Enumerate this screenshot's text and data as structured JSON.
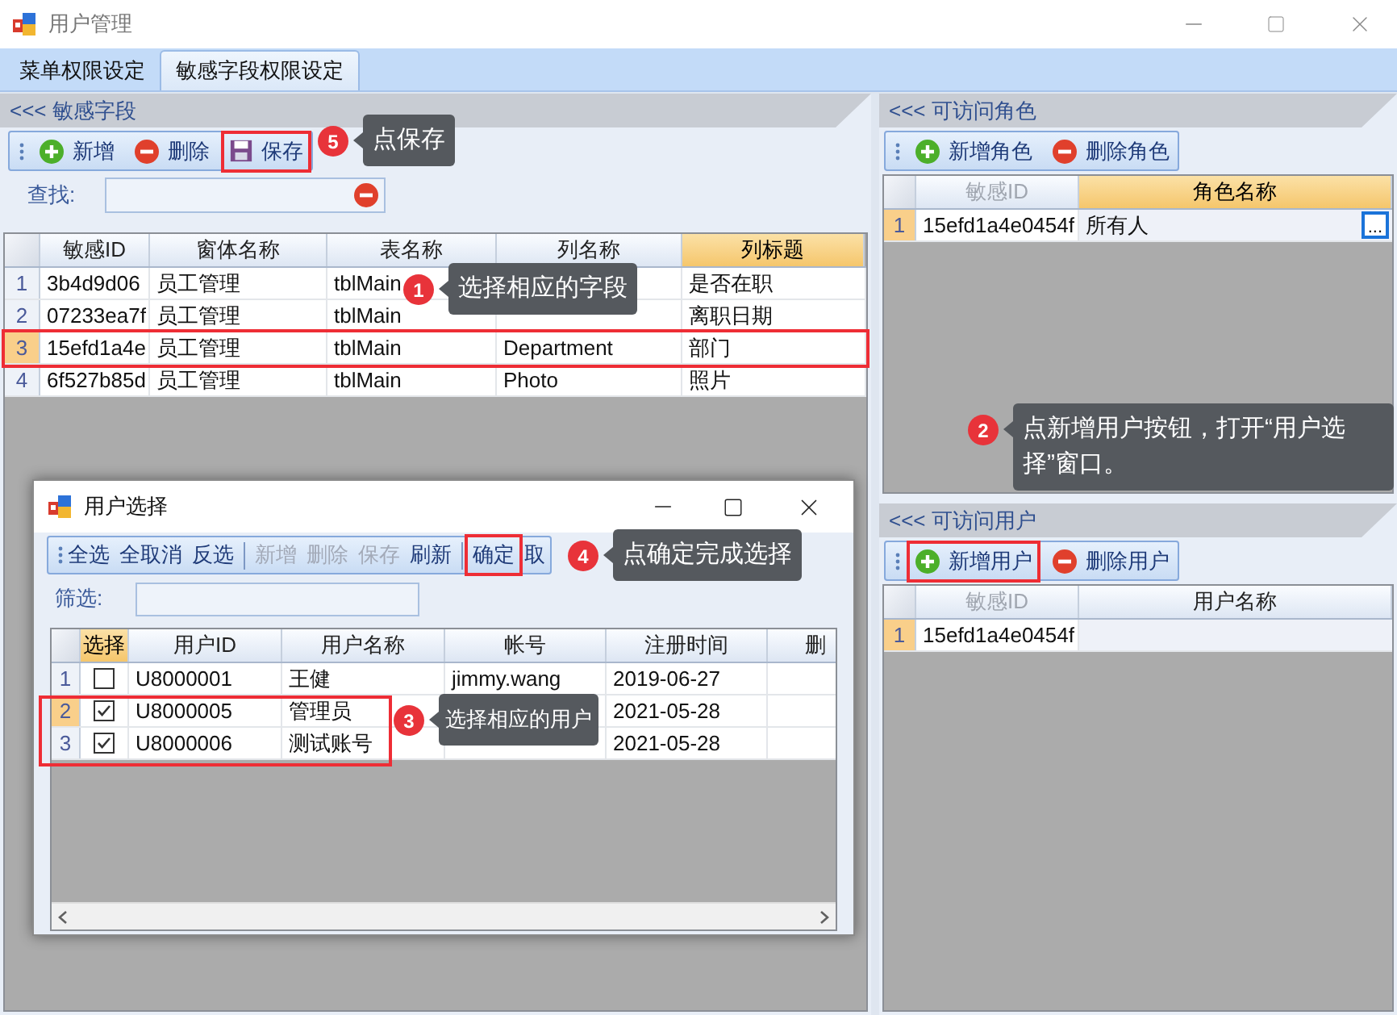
{
  "window": {
    "title": "用户管理"
  },
  "tabs": [
    {
      "label": "菜单权限设定",
      "selected": false
    },
    {
      "label": "敏感字段权限设定",
      "selected": true
    }
  ],
  "fields_panel": {
    "header": "<<< 敏感字段",
    "toolbar": [
      {
        "label": "新增",
        "kind": "add"
      },
      {
        "label": "删除",
        "kind": "remove"
      },
      {
        "label": "保存",
        "kind": "save",
        "highlighted": true
      }
    ],
    "search": {
      "label": "查找:"
    },
    "table": {
      "columns": [
        {
          "label": "敏感ID",
          "selected": false
        },
        {
          "label": "窗体名称",
          "selected": false
        },
        {
          "label": "表名称",
          "selected": false
        },
        {
          "label": "列名称",
          "selected": false
        },
        {
          "label": "列标题",
          "selected": true
        }
      ],
      "rows": [
        {
          "number": "1",
          "selected": false,
          "sensitive_id": "3b4d9d06",
          "form": "员工管理",
          "table": "tblMain",
          "caption": "是否在职"
        },
        {
          "number": "2",
          "selected": false,
          "sensitive_id": "07233ea7f",
          "form": "员工管理",
          "table": "tblMain",
          "caption": "离职日期"
        },
        {
          "number": "3",
          "selected": true,
          "highlighted": true,
          "sensitive_id": "15efd1a4e",
          "form": "员工管理",
          "table": "tblMain",
          "column": "Department",
          "caption": "部门"
        },
        {
          "number": "4",
          "selected": false,
          "sensitive_id": "6f527b85d",
          "form": "员工管理",
          "table": "tblMain",
          "column": "Photo",
          "caption": "照片"
        }
      ]
    }
  },
  "roles_panel": {
    "header": "<<< 可访问角色",
    "toolbar": [
      {
        "label": "新增角色",
        "kind": "add"
      },
      {
        "label": "删除角色",
        "kind": "remove"
      }
    ],
    "table": {
      "columns": [
        {
          "label": "敏感ID",
          "selected": false,
          "disabled": true
        },
        {
          "label": "角色名称",
          "selected": true,
          "disabled": false
        }
      ],
      "rows": [
        {
          "number": "1",
          "selected": true,
          "sensitive_id": "15efd1a4e0454f",
          "name": "所有人",
          "edit_button": "..."
        }
      ]
    }
  },
  "users_panel": {
    "header": "<<< 可访问用户",
    "toolbar": [
      {
        "label": "新增用户",
        "kind": "add",
        "highlighted": true
      },
      {
        "label": "删除用户",
        "kind": "remove"
      }
    ],
    "table": {
      "columns": [
        {
          "label": "敏感ID",
          "selected": false,
          "disabled": true
        },
        {
          "label": "用户名称",
          "selected": false,
          "disabled": false
        }
      ],
      "rows": [
        {
          "number": "1",
          "selected": true,
          "sensitive_id": "15efd1a4e0454f"
        }
      ]
    }
  },
  "dialog": {
    "title": "用户选择",
    "toolbar": [
      {
        "kind": "button",
        "label": "全选",
        "disabled": false
      },
      {
        "kind": "button",
        "label": "全取消",
        "disabled": false
      },
      {
        "kind": "button",
        "label": "反选",
        "disabled": false
      },
      {
        "kind": "separator"
      },
      {
        "kind": "button",
        "label": "新增",
        "disabled": true
      },
      {
        "kind": "button",
        "label": "删除",
        "disabled": true
      },
      {
        "kind": "button",
        "label": "保存",
        "disabled": true
      },
      {
        "kind": "button",
        "label": "刷新",
        "disabled": false
      },
      {
        "kind": "separator"
      },
      {
        "kind": "button",
        "label": "确定",
        "disabled": false,
        "highlighted": true
      },
      {
        "kind": "button",
        "label": "取",
        "disabled": false
      }
    ],
    "filter": {
      "label": "筛选:"
    },
    "table": {
      "columns": [
        {
          "label": "选择",
          "selected": true
        },
        {
          "label": "用户ID",
          "selected": false
        },
        {
          "label": "用户名称",
          "selected": false
        },
        {
          "label": "帐号",
          "selected": false
        },
        {
          "label": "注册时间",
          "selected": false
        },
        {
          "label": "删",
          "selected": false
        }
      ],
      "rows": [
        {
          "number": "1",
          "selected": false,
          "checked": false,
          "user_id": "U8000001",
          "user_name": "王健",
          "account": "jimmy.wang",
          "registered": "2019-06-27"
        },
        {
          "number": "2",
          "selected": true,
          "checked": true,
          "user_id": "U8000005",
          "user_name": "管理员",
          "registered": "2021-05-28"
        },
        {
          "number": "3",
          "selected": false,
          "checked": true,
          "user_id": "U8000006",
          "user_name": "测试账号",
          "registered": "2021-05-28"
        }
      ]
    }
  },
  "callouts": [
    {
      "number": "1",
      "text": "选择相应的字段"
    },
    {
      "number": "2",
      "text": "点新增用户按钮，打开“用户选择”窗口。"
    },
    {
      "number": "3",
      "text": "选择相应的用户"
    },
    {
      "number": "4",
      "text": "点确定完成选择"
    },
    {
      "number": "5",
      "text": "点保存"
    }
  ]
}
